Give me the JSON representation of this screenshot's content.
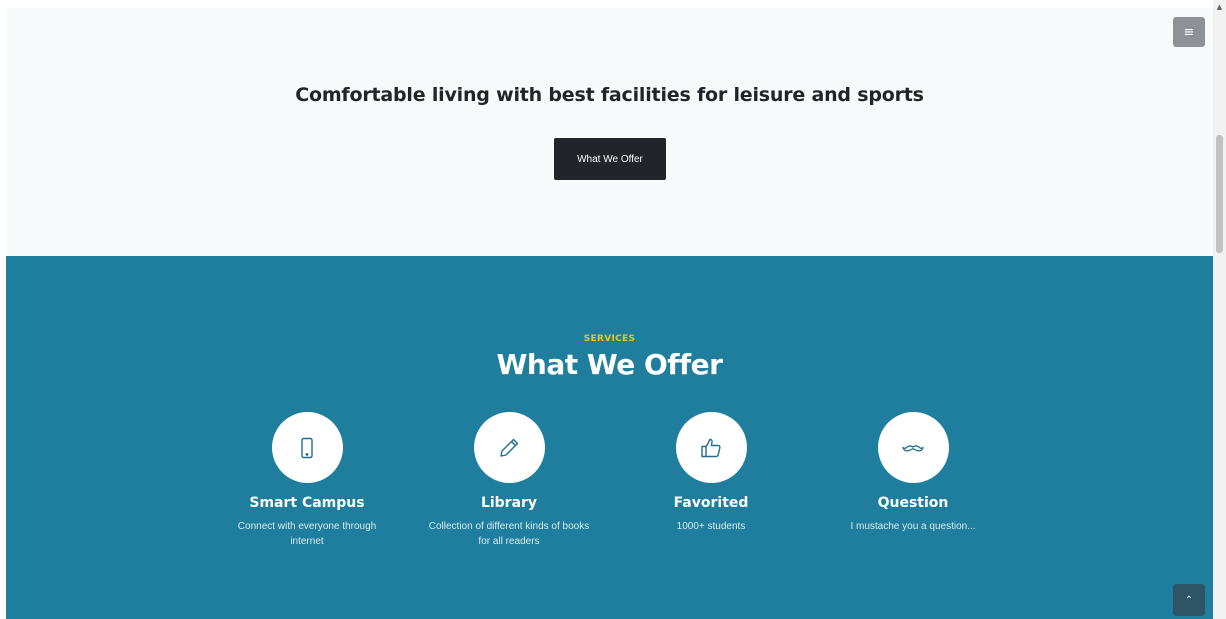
{
  "hero": {
    "title": "Comfortable living with best facilities for leisure and sports",
    "button_label": "What We Offer"
  },
  "menu": {
    "icon": "menu-icon",
    "glyph": "≡"
  },
  "services": {
    "kicker": "SERVICES",
    "title": "What We Offer",
    "items": [
      {
        "name": "Smart Campus",
        "desc": "Connect with everyone through internet",
        "icon": "mobile-phone-icon"
      },
      {
        "name": "Library",
        "desc": "Collection of different kinds of books for all readers",
        "icon": "pencil-icon"
      },
      {
        "name": "Favorited",
        "desc": "1000+ students",
        "icon": "thumbs-up-icon"
      },
      {
        "name": "Question",
        "desc": "I mustache you a question...",
        "icon": "mustache-icon"
      }
    ]
  },
  "back_to_top": {
    "icon": "chevron-up-icon",
    "glyph": "⌃"
  },
  "colors": {
    "hero_bg": "#f8f9fa",
    "button_dark": "#212529",
    "services_bg": "#1f7e9e",
    "accent_yellow": "#f0c419",
    "icon_stroke": "#1f6f8b"
  }
}
